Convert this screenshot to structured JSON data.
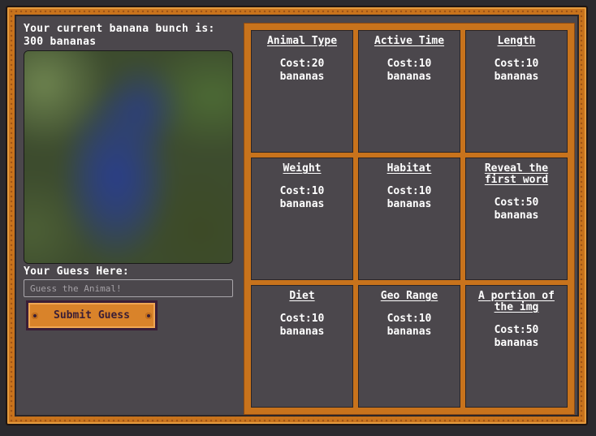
{
  "status": {
    "banana_text": "Your current banana bunch is: 300 bananas"
  },
  "guess": {
    "label": "Your Guess Here:",
    "placeholder": "Guess the Animal!",
    "value": "",
    "submit_label": "Submit Guess"
  },
  "hints": [
    {
      "title": "Animal Type",
      "cost": "Cost:20 bananas"
    },
    {
      "title": "Active Time",
      "cost": "Cost:10 bananas"
    },
    {
      "title": "Length",
      "cost": "Cost:10 bananas"
    },
    {
      "title": "Weight",
      "cost": "Cost:10 bananas"
    },
    {
      "title": "Habitat",
      "cost": "Cost:10 bananas"
    },
    {
      "title": "Reveal the first word",
      "cost": "Cost:50 bananas"
    },
    {
      "title": "Diet",
      "cost": "Cost:10 bananas"
    },
    {
      "title": "Geo Range",
      "cost": "Cost:10 bananas"
    },
    {
      "title": "A portion of the img",
      "cost": "Cost:50 bananas"
    }
  ],
  "colors": {
    "frame": "#c8731c",
    "panel": "#4b474c",
    "button": "#d9832a",
    "button_text": "#3a1e36"
  }
}
